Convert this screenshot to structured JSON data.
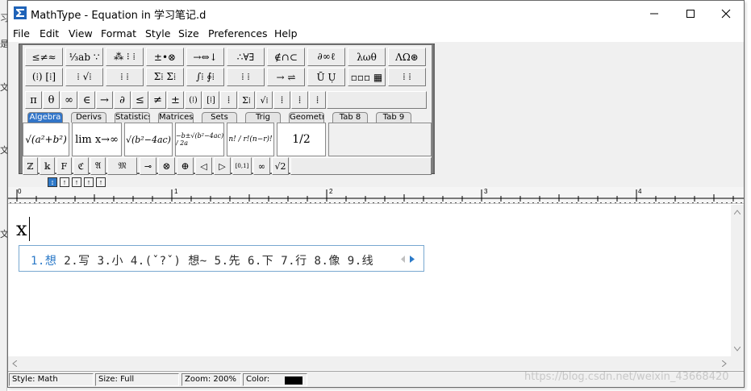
{
  "window": {
    "title": "MathType - Equation in 学习笔记.d"
  },
  "menu": [
    "File",
    "Edit",
    "View",
    "Format",
    "Style",
    "Size",
    "Preferences",
    "Help"
  ],
  "palette_row1": [
    "≤≠≈",
    "⅓ab ∵",
    "⁂ ⁝ ⁞",
    "±•⊗",
    "→⇔↓",
    "∴∀∃",
    "∉∩⊂",
    "∂∞ℓ",
    "λωθ",
    "ΛΩ⊛"
  ],
  "palette_row2": [
    "(⁞) [⁞]",
    "⁞ √⁞",
    "⁞ ⁞",
    "Σ⁞ Σ⁞",
    "∫⁞ ∮⁞",
    "⁞ ⁞",
    "→ ⇌",
    "Ū Ụ",
    "▫▫▫ ▦",
    "⁞ ⁞"
  ],
  "symbols": [
    "π",
    "θ",
    "∞",
    "∈",
    "→",
    "∂",
    "≤",
    "≠",
    "±",
    "(⁞)",
    "[⁞]",
    "⁞",
    "Σ⁞",
    "√⁞",
    "⁞",
    "⁞",
    "⁞"
  ],
  "tabs": [
    "Algebra",
    "Derivs",
    "Statistics",
    "Matrices",
    "Sets",
    "Trig",
    "Geometry",
    "Tab 8",
    "Tab 9"
  ],
  "templates": [
    "√(a²+b²)",
    "lim x→∞",
    "√(b²−4ac)",
    "−b±√(b²−4ac) / 2a",
    "n! / r!(n−r)!",
    "1/2"
  ],
  "bottom_row": [
    "ℤ",
    "𝕜",
    "F",
    "ℭ",
    "𝔄",
    "𝔐",
    "⊸",
    "⊗",
    "⊕",
    "◁",
    "▷",
    "[0,1]",
    "∞",
    "√2"
  ],
  "size_toggles": [
    "↕",
    "↑",
    "↑",
    "↑",
    "↑"
  ],
  "ruler": {
    "labels": [
      "0",
      "1",
      "2",
      "3",
      "4"
    ]
  },
  "editor": {
    "equation": "x"
  },
  "ime": {
    "first": "1.想",
    "candidates": "2.写 3.小 4.(ˇ?ˇ) 想~ 5.先 6.下 7.行 8.像 9.线"
  },
  "status": {
    "style": "Style: Math",
    "size": "Size: Full",
    "zoom": "Zoom: 200%",
    "color_label": "Color:",
    "color_value": "#000000"
  },
  "watermark": "https://blog.csdn.net/weixin_43668420",
  "left_edge_chars": [
    "习",
    "是",
    "文",
    "文",
    "文"
  ]
}
